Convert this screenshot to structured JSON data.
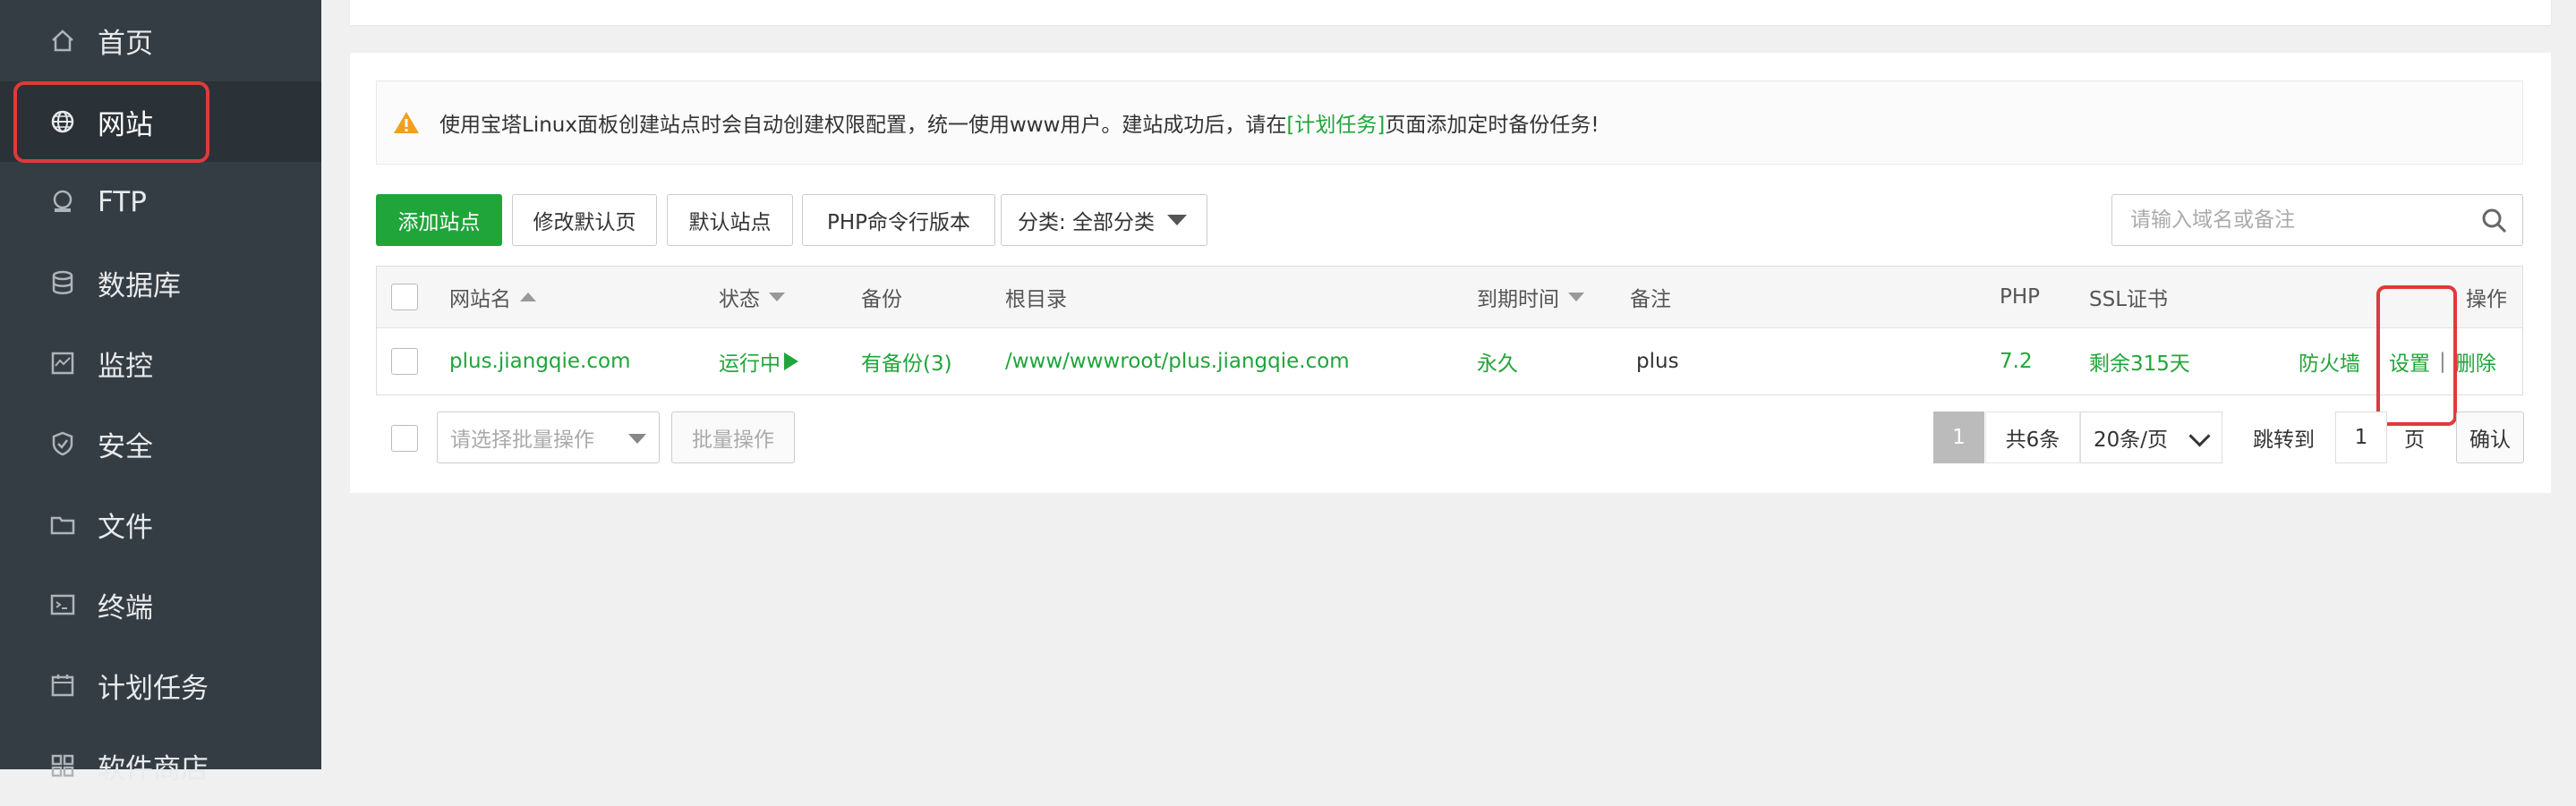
{
  "sidebar": {
    "items": [
      {
        "label": "首页",
        "icon": "home-icon"
      },
      {
        "label": "网站",
        "icon": "globe-icon",
        "active": true
      },
      {
        "label": "FTP",
        "icon": "ftp-icon"
      },
      {
        "label": "数据库",
        "icon": "database-icon"
      },
      {
        "label": "监控",
        "icon": "monitor-icon"
      },
      {
        "label": "安全",
        "icon": "shield-icon"
      },
      {
        "label": "文件",
        "icon": "folder-icon"
      },
      {
        "label": "终端",
        "icon": "terminal-icon"
      },
      {
        "label": "计划任务",
        "icon": "calendar-icon"
      },
      {
        "label": "软件商店",
        "icon": "apps-icon"
      }
    ]
  },
  "notice": {
    "text_before": "使用宝塔Linux面板创建站点时会自动创建权限配置，统一使用www用户。建站成功后，请在",
    "link": "[计划任务]",
    "text_after": "页面添加定时备份任务!"
  },
  "toolbar": {
    "add_site": "添加站点",
    "modify_default_page": "修改默认页",
    "default_site": "默认站点",
    "php_cli_version": "PHP命令行版本",
    "category": "分类: 全部分类"
  },
  "search": {
    "placeholder": "请输入域名或备注"
  },
  "table": {
    "headers": {
      "name": "网站名",
      "status": "状态",
      "backup": "备份",
      "root": "根目录",
      "expire": "到期时间",
      "note": "备注",
      "php": "PHP",
      "ssl": "SSL证书",
      "ops": "操作"
    },
    "rows": [
      {
        "name": "plus.jiangqie.com",
        "status": "运行中",
        "backup": "有备份(3)",
        "root": "/www/wwwroot/plus.jiangqie.com",
        "expire": "永久",
        "note": "plus",
        "php": "7.2",
        "ssl": "剩余315天",
        "ops": {
          "firewall": "防火墙",
          "settings": "设置",
          "separator": "|",
          "delete": "删除"
        }
      }
    ]
  },
  "bottom": {
    "batch_placeholder": "请选择批量操作",
    "batch_button": "批量操作",
    "current_page": "1",
    "total": "共6条",
    "page_size": "20条/页",
    "jump_label": "跳转到",
    "jump_value": "1",
    "page_unit": "页",
    "confirm": "确认"
  },
  "colors": {
    "sidebar_bg": "#353d44",
    "accent_green": "#20a53a",
    "highlight_red": "#e03a3a",
    "warning_orange": "#f0a020"
  }
}
